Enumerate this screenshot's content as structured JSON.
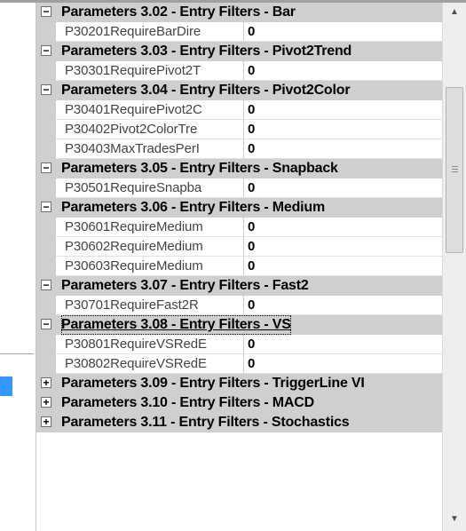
{
  "categories": [
    {
      "title": "Parameters 3.02 - Entry Filters - Bar",
      "expanded": true,
      "properties": [
        {
          "name": "P30201RequireBarDire",
          "value": "0"
        }
      ]
    },
    {
      "title": "Parameters 3.03 - Entry Filters - Pivot2Trend",
      "expanded": true,
      "properties": [
        {
          "name": "P30301RequirePivot2T",
          "value": "0"
        }
      ]
    },
    {
      "title": "Parameters 3.04 - Entry Filters - Pivot2Color",
      "expanded": true,
      "properties": [
        {
          "name": "P30401RequirePivot2C",
          "value": "0"
        },
        {
          "name": "P30402Pivot2ColorTre",
          "value": "0"
        },
        {
          "name": "P30403MaxTradesPerI",
          "value": "0"
        }
      ]
    },
    {
      "title": "Parameters 3.05 - Entry Filters - Snapback",
      "expanded": true,
      "properties": [
        {
          "name": "P30501RequireSnapba",
          "value": "0"
        }
      ]
    },
    {
      "title": "Parameters 3.06 - Entry Filters - Medium",
      "expanded": true,
      "properties": [
        {
          "name": "P30601RequireMedium",
          "value": "0"
        },
        {
          "name": "P30602RequireMedium",
          "value": "0"
        },
        {
          "name": "P30603RequireMedium",
          "value": "0"
        }
      ]
    },
    {
      "title": "Parameters 3.07 - Entry Filters - Fast2",
      "expanded": true,
      "properties": [
        {
          "name": "P30701RequireFast2R",
          "value": "0"
        }
      ]
    },
    {
      "title": "Parameters 3.08 - Entry Filters - VS",
      "expanded": true,
      "focused": true,
      "properties": [
        {
          "name": "P30801RequireVSRedE",
          "value": "0"
        },
        {
          "name": "P30802RequireVSRedE",
          "value": "0"
        }
      ]
    },
    {
      "title": "Parameters 3.09 - Entry Filters - TriggerLine VI",
      "expanded": false,
      "properties": []
    },
    {
      "title": "Parameters 3.10 - Entry Filters - MACD",
      "expanded": false,
      "properties": []
    },
    {
      "title": "Parameters 3.11 - Entry Filters - Stochastics",
      "expanded": false,
      "properties": []
    }
  ],
  "glyphs": {
    "collapse": "−",
    "expand": "+"
  },
  "scrollbar": {
    "up_icon": "▲",
    "down_icon": "▼",
    "thumb_position": 0.2
  }
}
